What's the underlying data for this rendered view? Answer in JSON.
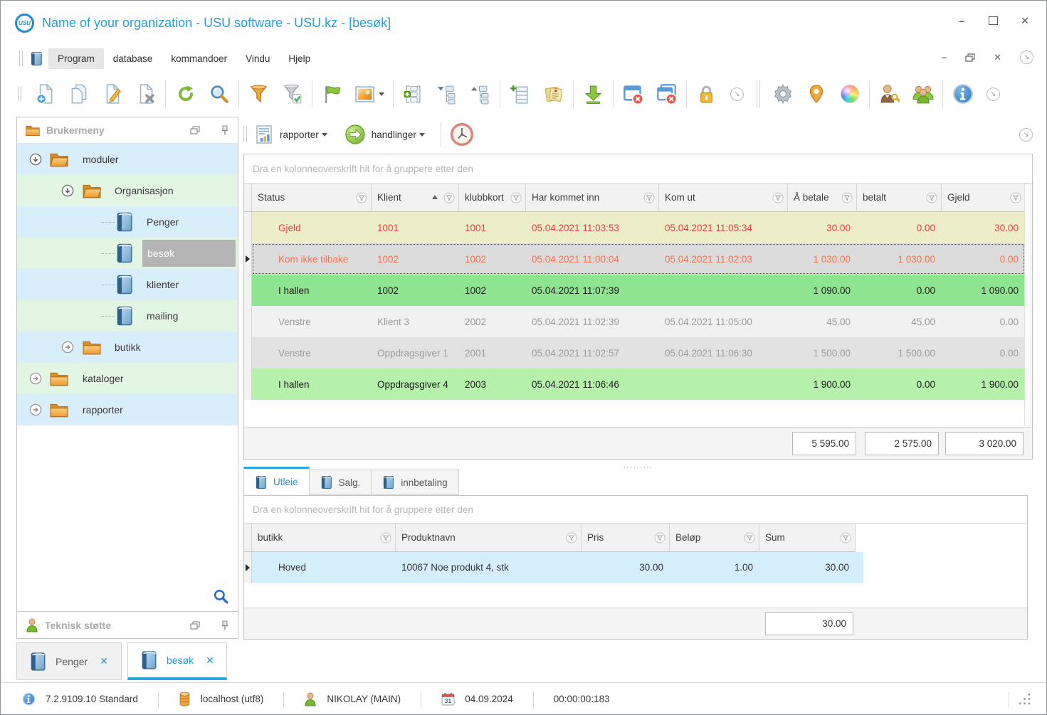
{
  "window": {
    "logo_text": "USU",
    "title": "Name of your organization - USU software - USU.kz - [besøk]"
  },
  "menu": {
    "items": [
      "Program",
      "database",
      "kommandoer",
      "Vindu",
      "Hjelp"
    ]
  },
  "sidebar": {
    "header": "Brukermeny",
    "support_header": "Teknisk støtte",
    "tree": [
      {
        "label": "moduler"
      },
      {
        "label": "Organisasjon"
      },
      {
        "label": "Penger"
      },
      {
        "label": "besøk"
      },
      {
        "label": "klienter"
      },
      {
        "label": "mailing"
      },
      {
        "label": "butikk"
      },
      {
        "label": "kataloger"
      },
      {
        "label": "rapporter"
      }
    ]
  },
  "actionbar": {
    "reports_label": "rapporter",
    "actions_label": "handlinger"
  },
  "main_table": {
    "group_hint": "Dra en kolonneoverskrift hit for å gruppere etter den",
    "columns": [
      "Status",
      "Klient",
      "klubbkort",
      "Har kommet inn",
      "Kom ut",
      "Å betale",
      "betalt",
      "Gjeld"
    ],
    "rows": [
      {
        "status": "Gjeld",
        "klient": "1001",
        "klubbkort": "1001",
        "inn": "05.04.2021 11:03:53",
        "ut": "05.04.2021 11:05:34",
        "a_betale": "30.00",
        "betalt": "0.00",
        "gjeld": "30.00"
      },
      {
        "status": "Kom ikke tilbake",
        "klient": "1002",
        "klubbkort": "1002",
        "inn": "05.04.2021 11:00:04",
        "ut": "05.04.2021 11:02:03",
        "a_betale": "1 030.00",
        "betalt": "1 030.00",
        "gjeld": "0.00"
      },
      {
        "status": "I hallen",
        "klient": "1002",
        "klubbkort": "1002",
        "inn": "05.04.2021 11:07:39",
        "ut": "",
        "a_betale": "1 090.00",
        "betalt": "0.00",
        "gjeld": "1 090.00"
      },
      {
        "status": "Venstre",
        "klient": "Klient 3",
        "klubbkort": "2002",
        "inn": "05.04.2021 11:02:39",
        "ut": "05.04.2021 11:05:00",
        "a_betale": "45.00",
        "betalt": "45.00",
        "gjeld": "0.00"
      },
      {
        "status": "Venstre",
        "klient": "Oppdragsgiver 1",
        "klubbkort": "2001",
        "inn": "05.04.2021 11:02:57",
        "ut": "05.04.2021 11:06:30",
        "a_betale": "1 500.00",
        "betalt": "1 500.00",
        "gjeld": "0.00"
      },
      {
        "status": "I hallen",
        "klient": "Oppdragsgiver 4",
        "klubbkort": "2003",
        "inn": "05.04.2021 11:06:46",
        "ut": "",
        "a_betale": "1 900.00",
        "betalt": "0.00",
        "gjeld": "1 900.00"
      }
    ],
    "totals": {
      "a_betale": "5 595.00",
      "betalt": "2 575.00",
      "gjeld": "3 020.00"
    }
  },
  "detail_tabs": [
    {
      "label": "Utleie"
    },
    {
      "label": "Salg."
    },
    {
      "label": "innbetaling"
    }
  ],
  "detail_table": {
    "group_hint": "Dra en kolonneoverskrift hit for å gruppere etter den",
    "columns": [
      "butikk",
      "Produktnavn",
      "Pris",
      "Beløp",
      "Sum"
    ],
    "rows": [
      {
        "butikk": "Hoved",
        "produktnavn": "10067 Noe produkt 4, stk",
        "pris": "30.00",
        "belop": "1.00",
        "sum": "30.00"
      }
    ],
    "total_sum": "30.00"
  },
  "window_tabs": [
    {
      "label": "Penger"
    },
    {
      "label": "besøk"
    }
  ],
  "statusbar": {
    "version": "7.2.9109.10 Standard",
    "database": "localhost (utf8)",
    "user": "NIKOLAY (MAIN)",
    "calendar_day": "31",
    "date": "04.09.2024",
    "timer": "00:00:00:183"
  },
  "colors": {
    "accent": "#29a8e0",
    "title": "#24a0dc",
    "debt_red": "#e04040",
    "not_back_orange": "#f4734d",
    "in_hall_green": "#8fe48f"
  }
}
